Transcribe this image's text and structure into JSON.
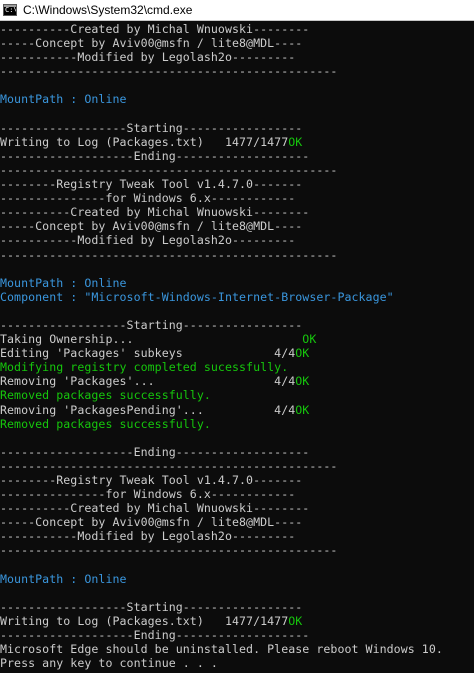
{
  "window": {
    "title": "C:\\Windows\\System32\\cmd.exe",
    "icon": "console-icon"
  },
  "colors": {
    "background": "#0c0c0c",
    "text": "#cccccc",
    "ok": "#16c60c",
    "info": "#3a96dd"
  },
  "console": {
    "lines": [
      {
        "text": "----------Created by Michal Wnuowski--------",
        "kind": "normal"
      },
      {
        "text": "-----Concept by Aviv00@msfn / lite8@MDL----",
        "kind": "normal"
      },
      {
        "text": "-----------Modified by Legolash2o---------",
        "kind": "normal"
      },
      {
        "text": "------------------------------------------------",
        "kind": "normal"
      },
      {
        "text": "",
        "kind": "normal"
      },
      {
        "text": "MountPath : Online",
        "kind": "cyan"
      },
      {
        "text": "",
        "kind": "normal"
      },
      {
        "text": "------------------Starting-----------------",
        "kind": "normal"
      },
      {
        "text": "Writing to Log (Packages.txt)   1477/1477",
        "kind": "normal",
        "suffix": "OK"
      },
      {
        "text": "-------------------Ending-------------------",
        "kind": "normal"
      },
      {
        "text": "------------------------------------------------",
        "kind": "normal"
      },
      {
        "text": "--------Registry Tweak Tool v1.4.7.0-------",
        "kind": "normal"
      },
      {
        "text": "---------------for Windows 6.x------------",
        "kind": "normal"
      },
      {
        "text": "----------Created by Michal Wnuowski--------",
        "kind": "normal"
      },
      {
        "text": "-----Concept by Aviv00@msfn / lite8@MDL----",
        "kind": "normal"
      },
      {
        "text": "-----------Modified by Legolash2o---------",
        "kind": "normal"
      },
      {
        "text": "------------------------------------------------",
        "kind": "normal"
      },
      {
        "text": "",
        "kind": "normal"
      },
      {
        "text": "MountPath : Online",
        "kind": "cyan"
      },
      {
        "text": "Component : \"Microsoft-Windows-Internet-Browser-Package\"",
        "kind": "cyan"
      },
      {
        "text": "",
        "kind": "normal"
      },
      {
        "text": "------------------Starting-----------------",
        "kind": "normal"
      },
      {
        "text": "Taking Ownership...                        ",
        "kind": "normal",
        "suffix": "OK"
      },
      {
        "text": "Editing 'Packages' subkeys             4/4",
        "kind": "normal",
        "suffix": "OK"
      },
      {
        "text": "Modifying registry completed sucessfully.",
        "kind": "green"
      },
      {
        "text": "Removing 'Packages'...                 4/4",
        "kind": "normal",
        "suffix": "OK"
      },
      {
        "text": "Removed packages successfully.",
        "kind": "green"
      },
      {
        "text": "Removing 'PackagesPending'...          4/4",
        "kind": "normal",
        "suffix": "OK"
      },
      {
        "text": "Removed packages successfully.",
        "kind": "green"
      },
      {
        "text": "",
        "kind": "normal"
      },
      {
        "text": "-------------------Ending-------------------",
        "kind": "normal"
      },
      {
        "text": "------------------------------------------------",
        "kind": "normal"
      },
      {
        "text": "--------Registry Tweak Tool v1.4.7.0-------",
        "kind": "normal"
      },
      {
        "text": "---------------for Windows 6.x------------",
        "kind": "normal"
      },
      {
        "text": "----------Created by Michal Wnuowski--------",
        "kind": "normal"
      },
      {
        "text": "-----Concept by Aviv00@msfn / lite8@MDL----",
        "kind": "normal"
      },
      {
        "text": "-----------Modified by Legolash2o---------",
        "kind": "normal"
      },
      {
        "text": "------------------------------------------------",
        "kind": "normal"
      },
      {
        "text": "",
        "kind": "normal"
      },
      {
        "text": "MountPath : Online",
        "kind": "cyan"
      },
      {
        "text": "",
        "kind": "normal"
      },
      {
        "text": "------------------Starting-----------------",
        "kind": "normal"
      },
      {
        "text": "Writing to Log (Packages.txt)   1477/1477",
        "kind": "normal",
        "suffix": "OK"
      },
      {
        "text": "-------------------Ending-------------------",
        "kind": "normal"
      },
      {
        "text": "Microsoft Edge should be uninstalled. Please reboot Windows 10.",
        "kind": "normal"
      },
      {
        "text": "Press any key to continue . . .",
        "kind": "normal"
      }
    ]
  }
}
